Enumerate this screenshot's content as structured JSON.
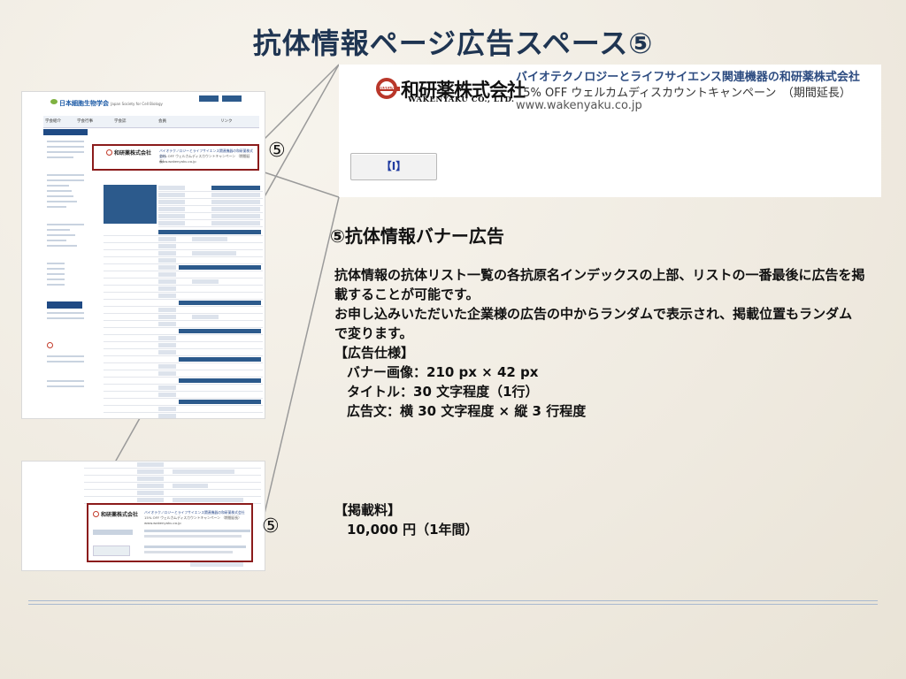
{
  "slide": {
    "title": "抗体情報ページ広告スペース⑤",
    "marker": "⑤"
  },
  "thumbnail": {
    "site_name": "日本細胞生物学会",
    "site_name_en": "Japan Society for Cell Biology",
    "nav_items": [
      "学会紹介",
      "学会行事",
      "学会誌",
      "会員",
      "リンク"
    ]
  },
  "mini_banner": {
    "company": "和研薬株式会社",
    "line1": "バイオテクノロジーとライフサイエンス関連機器の和研薬株式会社",
    "line2": "15% OFF ウェルカムディスカウントキャンペーン （期間延長）",
    "url": "www.wakenyaku.co.jp"
  },
  "banner": {
    "logo_mark": "WAKEN",
    "company": "和研薬株式会社",
    "company_en": "WAKENYAKU CO., LTD.",
    "line1": "バイオテクノロジーとライフサイエンス関連機器の和研薬株式会社",
    "line2": "15% OFF ウェルカムディスカウントキャンペーン　（期間延長）",
    "line3": "www.wakenyaku.co.jp",
    "button_label": "【I】"
  },
  "section": {
    "heading": "⑤抗体情報バナー広告",
    "paragraph1": "抗体情報の抗体リスト一覧の各抗原名インデックスの上部、リストの一番最後に広告を掲載することが可能です。",
    "paragraph2": "お申し込みいただいた企業様の広告の中からランダムで表示され、掲載位置もランダムで変ります。",
    "spec_heading": "【広告仕様】",
    "spec_image": "バナー画像：210 px × 42 px",
    "spec_title": "タイトル：30 文字程度（1行）",
    "spec_text": "広告文：横 30 文字程度 × 縦 3 行程度",
    "fee_heading": "【掲載料】",
    "fee_value": "10,000 円（1年間）"
  }
}
